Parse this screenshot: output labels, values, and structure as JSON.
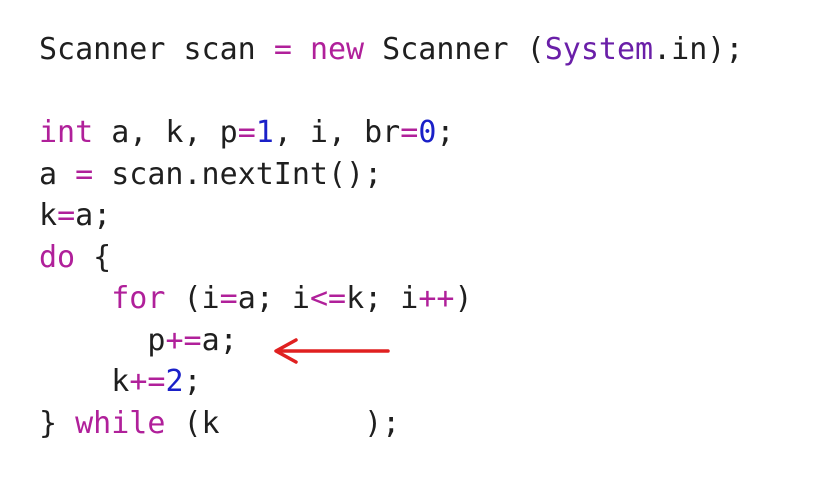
{
  "code": {
    "lines": [
      {
        "tokens": [
          {
            "text": "Scanner scan ",
            "kind": "plain"
          },
          {
            "text": "=",
            "kind": "op"
          },
          {
            "text": " ",
            "kind": "plain"
          },
          {
            "text": "new",
            "kind": "kw"
          },
          {
            "text": " Scanner (",
            "kind": "plain"
          },
          {
            "text": "System",
            "kind": "cls"
          },
          {
            "text": ".in);",
            "kind": "plain"
          }
        ]
      },
      {
        "tokens": []
      },
      {
        "tokens": [
          {
            "text": "int",
            "kind": "kw"
          },
          {
            "text": " a, k, p",
            "kind": "plain"
          },
          {
            "text": "=",
            "kind": "op"
          },
          {
            "text": "1",
            "kind": "num"
          },
          {
            "text": ", i, br",
            "kind": "plain"
          },
          {
            "text": "=",
            "kind": "op"
          },
          {
            "text": "0",
            "kind": "num"
          },
          {
            "text": ";",
            "kind": "plain"
          }
        ]
      },
      {
        "tokens": [
          {
            "text": "a ",
            "kind": "plain"
          },
          {
            "text": "=",
            "kind": "op"
          },
          {
            "text": " scan.nextInt();",
            "kind": "plain"
          }
        ]
      },
      {
        "tokens": [
          {
            "text": "k",
            "kind": "plain"
          },
          {
            "text": "=",
            "kind": "op"
          },
          {
            "text": "a;",
            "kind": "plain"
          }
        ]
      },
      {
        "tokens": [
          {
            "text": "do",
            "kind": "kw"
          },
          {
            "text": " {",
            "kind": "plain"
          }
        ]
      },
      {
        "tokens": [
          {
            "text": "    ",
            "kind": "plain"
          },
          {
            "text": "for",
            "kind": "kw"
          },
          {
            "text": " (i",
            "kind": "plain"
          },
          {
            "text": "=",
            "kind": "op"
          },
          {
            "text": "a; i",
            "kind": "plain"
          },
          {
            "text": "<=",
            "kind": "op"
          },
          {
            "text": "k; i",
            "kind": "plain"
          },
          {
            "text": "++",
            "kind": "op"
          },
          {
            "text": ")",
            "kind": "plain"
          }
        ]
      },
      {
        "tokens": [
          {
            "text": "      p",
            "kind": "plain"
          },
          {
            "text": "+=",
            "kind": "op"
          },
          {
            "text": "a;",
            "kind": "plain"
          }
        ]
      },
      {
        "tokens": [
          {
            "text": "    k",
            "kind": "plain"
          },
          {
            "text": "+=",
            "kind": "op"
          },
          {
            "text": "2",
            "kind": "num"
          },
          {
            "text": ";",
            "kind": "plain"
          }
        ]
      },
      {
        "tokens": [
          {
            "text": "} ",
            "kind": "plain"
          },
          {
            "text": "while",
            "kind": "kw"
          },
          {
            "text": " (k        );",
            "kind": "plain"
          }
        ]
      }
    ]
  },
  "annotation": {
    "arrow_color": "#e02020",
    "arrow_icon": "left-arrow-icon"
  }
}
